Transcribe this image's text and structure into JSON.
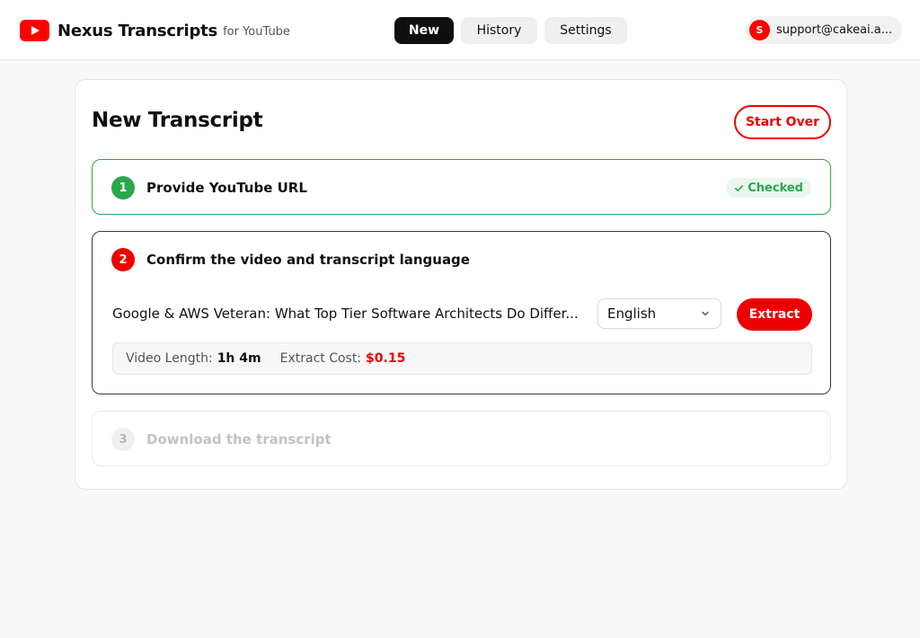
{
  "header": {
    "brand_name": "Nexus Transcripts",
    "brand_sub": "for YouTube",
    "tabs": [
      {
        "label": "New",
        "active": true
      },
      {
        "label": "History",
        "active": false
      },
      {
        "label": "Settings",
        "active": false
      }
    ],
    "account": {
      "avatar_letter": "S",
      "email": "support@cakeai.a..."
    }
  },
  "main": {
    "title": "New Transcript",
    "start_over_label": "Start Over",
    "steps": [
      {
        "number": "1",
        "label": "Provide YouTube URL",
        "status": "Checked"
      },
      {
        "number": "2",
        "label": "Confirm the video and transcript language"
      },
      {
        "number": "3",
        "label": "Download the transcript"
      }
    ],
    "video": {
      "title": "Google & AWS Veteran: What Top Tier Software Architects Do Differ...",
      "language": "English",
      "extract_label": "Extract",
      "length_label": "Video Length:",
      "length_value": "1h 4m",
      "cost_label": "Extract Cost:",
      "cost_value": "$0.15"
    }
  },
  "icons": {
    "logo": "youtube-logo-icon",
    "check": "check-icon",
    "chevron": "chevron-down-icon"
  },
  "colors": {
    "brand_red": "#ee0000",
    "success_green": "#2aa84a",
    "active_tab": "#0f0f0f"
  }
}
